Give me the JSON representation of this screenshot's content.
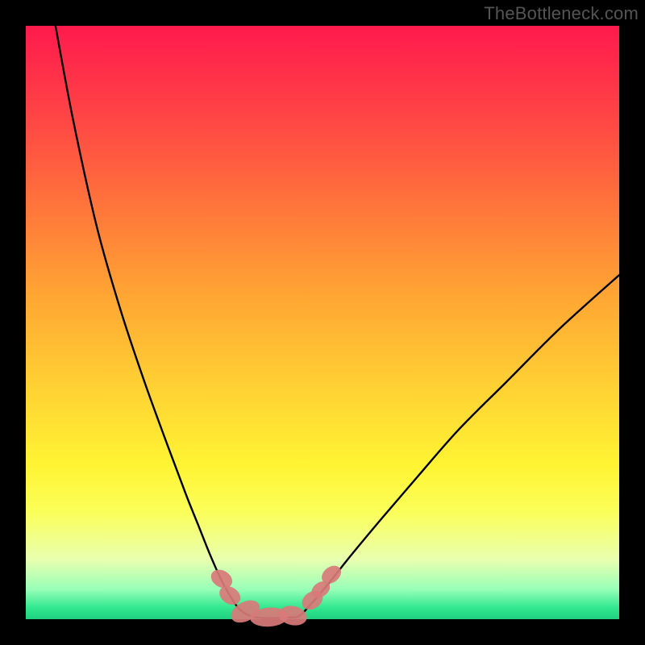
{
  "watermark": "TheBottleneck.com",
  "colors": {
    "curve": "#000000",
    "marker_fill": "#d97a7a",
    "marker_stroke": "#a63a3a",
    "bottom_band": "#1fd17f"
  },
  "chart_data": {
    "type": "line",
    "title": "",
    "xlabel": "",
    "ylabel": "",
    "xlim": [
      0,
      100
    ],
    "ylim": [
      0,
      100
    ],
    "series": [
      {
        "name": "left-curve",
        "x": [
          5,
          8,
          12,
          16,
          20,
          24,
          27,
          29,
          31,
          33,
          34.5,
          36,
          38
        ],
        "y": [
          100,
          84,
          66,
          52,
          40,
          29,
          21,
          16,
          11,
          6.5,
          3.8,
          1.7,
          0.5
        ]
      },
      {
        "name": "floor",
        "x": [
          38,
          40,
          42,
          44,
          46
        ],
        "y": [
          0.5,
          0.2,
          0.2,
          0.3,
          0.5
        ]
      },
      {
        "name": "right-curve",
        "x": [
          46,
          48,
          51,
          55,
          60,
          66,
          73,
          81,
          90,
          100
        ],
        "y": [
          0.5,
          2.5,
          6,
          11,
          17,
          24,
          32,
          40,
          49,
          58
        ]
      }
    ],
    "markers": [
      {
        "shape": "pill",
        "cx": 33.0,
        "cy": 6.8,
        "rx": 1.4,
        "ry": 1.9,
        "rot": -60
      },
      {
        "shape": "pill",
        "cx": 34.4,
        "cy": 4.0,
        "rx": 1.4,
        "ry": 1.9,
        "rot": -58
      },
      {
        "shape": "pill",
        "cx": 37.0,
        "cy": 1.3,
        "rx": 2.6,
        "ry": 1.6,
        "rot": -28
      },
      {
        "shape": "pill",
        "cx": 41.0,
        "cy": 0.35,
        "rx": 3.2,
        "ry": 1.6,
        "rot": -4
      },
      {
        "shape": "pill",
        "cx": 45.0,
        "cy": 0.6,
        "rx": 2.4,
        "ry": 1.6,
        "rot": 12
      },
      {
        "shape": "pill",
        "cx": 48.3,
        "cy": 3.2,
        "rx": 1.4,
        "ry": 1.9,
        "rot": 55
      },
      {
        "shape": "pill",
        "cx": 49.7,
        "cy": 5.0,
        "rx": 1.2,
        "ry": 1.7,
        "rot": 55
      },
      {
        "shape": "pill",
        "cx": 51.5,
        "cy": 7.5,
        "rx": 1.3,
        "ry": 1.8,
        "rot": 52
      }
    ]
  }
}
